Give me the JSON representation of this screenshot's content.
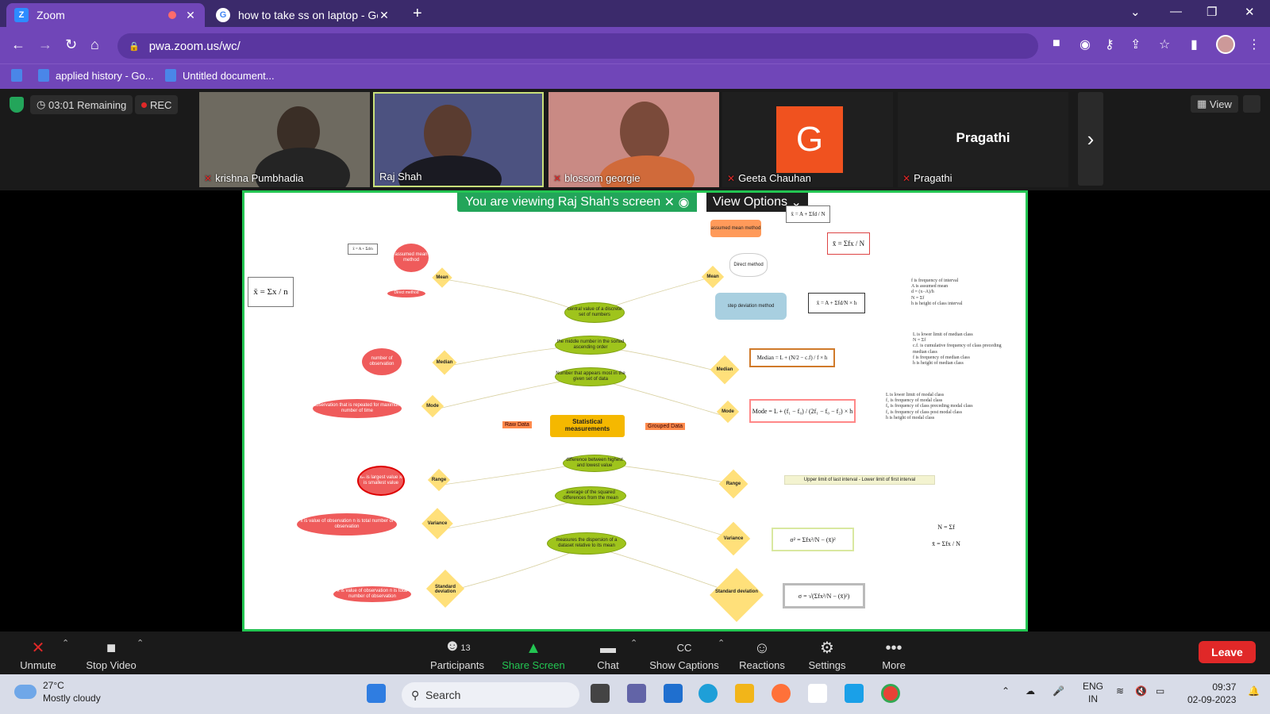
{
  "browser": {
    "tabs": [
      {
        "title": "Zoom",
        "favicon": "Z"
      },
      {
        "title": "how to take ss on laptop - Googl",
        "favicon": "G"
      }
    ],
    "url": "pwa.zoom.us/wc/",
    "bookmarks": [
      "applied history - Go...",
      "Untitled document..."
    ]
  },
  "meeting": {
    "timer": "03:01 Remaining",
    "rec_label": "REC",
    "participants": [
      {
        "name": "krishna Pumbhadia"
      },
      {
        "name": "Raj Shah"
      },
      {
        "name": "blossom georgie"
      },
      {
        "name": "Geeta Chauhan",
        "initial": "G"
      },
      {
        "name": "Pragathi",
        "display": "Pragathi"
      }
    ],
    "view_label": "View",
    "banner": "You are viewing Raj Shah's screen",
    "view_options": "View Options"
  },
  "mindmap": {
    "central": "Statistical measurements",
    "raw": "Raw Data",
    "grouped": "Grouped Data",
    "left_nodes": [
      "Mean",
      "Median",
      "Mode",
      "Range",
      "Variance",
      "Standard deviation"
    ],
    "right_nodes": [
      "Mean",
      "Median",
      "Mode",
      "Range",
      "Variance",
      "Standard deviation"
    ],
    "left_mean_methods": [
      "assumed mean method",
      "Direct method"
    ],
    "right_mean_methods": [
      "assumed mean method",
      "Direct method",
      "step deviation method"
    ],
    "green_nodes": [
      "central value of a discrete set of numbers",
      "the middle number in the sorted ascending order",
      "Number that appears most in the given set of data",
      "difference between highest and lowest value",
      "average of the squared differences from the mean",
      "measures the dispersion of a dataset relative to its mean"
    ],
    "left_red": [
      "number of observation",
      "observation that is repeated for maximum number of time",
      "xₘ is largest value xₗ is smallest value",
      "x is value of observation n is total number of observation",
      "x is value of observation n is total number of observation"
    ],
    "formulas": {
      "mean_raw": "x̄ = Σx / n",
      "mean_assumed_left": "x̄ = A + Σd/n",
      "mean_direct": "x̄ = Σfx / N",
      "mean_assumed_right": "x̄ = A + Σfd / N",
      "mean_step": "x̄ = A + Σfd/N × h",
      "median": "Median = L + (N/2 − c.f) / f × h",
      "mode": "Mode = L + (f₁ − f₀) / (2f₁ − f₀ − f₂) × h",
      "range_grouped": "Upper limit of last interval - Lower limit of first interval",
      "variance": "σ² = Σfx²/N − (x̄)²",
      "sd": "σ = √(Σfx²/N − (x̄)²)",
      "n_sum": "N = Σf",
      "xbar_fx": "x̄ = Σfx / N"
    },
    "notes": {
      "median_notes": "L is lower limit of median class\nN = Σf\nc.f. is cumulative frequency of class preceding median class\nf is frequency of median class\nh is height of median class",
      "mode_notes": "L is lower limit of modal class\nf₁ is frequency of modal class\nf₀ is frequency of class preceding modal class\nf₂ is frequency of class post modal class\nh is height of modal class",
      "step_notes": "f is frequency of interval\nA is assumed mean\nd = (x−A)/h\nN = Σf\nh is height of class interval"
    }
  },
  "toolbar": {
    "unmute": "Unmute",
    "stop_video": "Stop Video",
    "participants": "Participants",
    "participants_count": "13",
    "share": "Share Screen",
    "chat": "Chat",
    "captions": "Show Captions",
    "reactions": "Reactions",
    "settings": "Settings",
    "more": "More",
    "leave": "Leave"
  },
  "taskbar": {
    "temp": "27°C",
    "weather": "Mostly cloudy",
    "search": "Search",
    "lang1": "ENG",
    "lang2": "IN",
    "time": "09:37",
    "date": "02-09-2023"
  }
}
